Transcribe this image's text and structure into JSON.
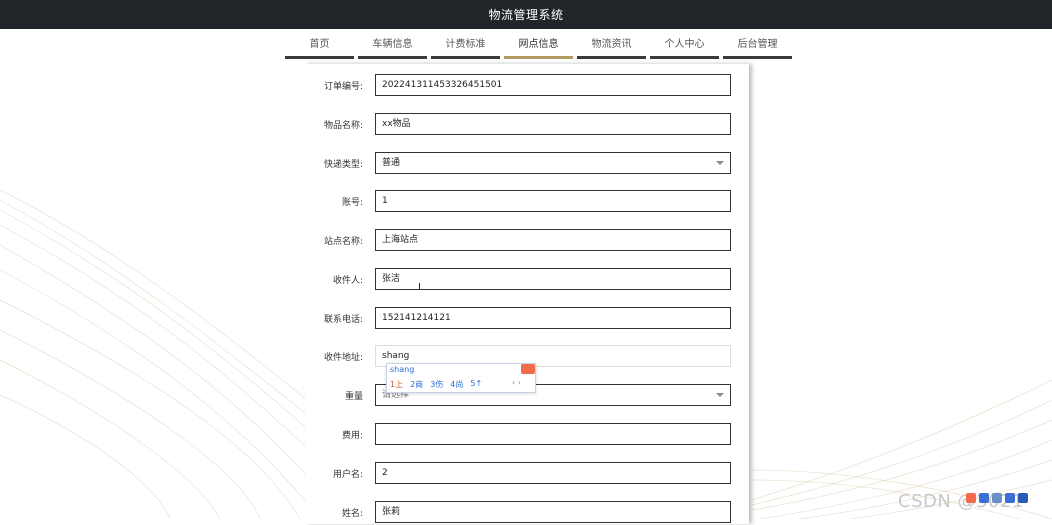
{
  "header": {
    "title": "物流管理系统"
  },
  "nav": {
    "tabs": [
      {
        "label": "首页",
        "active": false
      },
      {
        "label": "车辆信息",
        "active": false
      },
      {
        "label": "计费标准",
        "active": false
      },
      {
        "label": "网点信息",
        "active": true
      },
      {
        "label": "物流资讯",
        "active": false
      },
      {
        "label": "个人中心",
        "active": false
      },
      {
        "label": "后台管理",
        "active": false
      }
    ]
  },
  "form": {
    "order_no": {
      "label": "订单编号:",
      "value": "20224131145332645150​1"
    },
    "item_name": {
      "label": "物品名称:",
      "value": "xx物品"
    },
    "express_type": {
      "label": "快递类型:",
      "value": "普通"
    },
    "account": {
      "label": "账号:",
      "value": "1"
    },
    "station_name": {
      "label": "站点名称:",
      "value": "上海站点"
    },
    "receiver": {
      "label": "收件人:",
      "value": "张洁"
    },
    "phone": {
      "label": "联系电话:",
      "value": "152141214121"
    },
    "address": {
      "label": "收件地址:",
      "value": "shang"
    },
    "weight": {
      "label": "重量",
      "placeholder": "请选择"
    },
    "fee": {
      "label": "费用:",
      "value": ""
    },
    "username": {
      "label": "用户名:",
      "value": "2"
    },
    "name": {
      "label": "姓名:",
      "value": "张莉"
    }
  },
  "ime": {
    "composition": "shang",
    "candidates": [
      "1上",
      "2商",
      "3伤",
      "4尚",
      "5↑"
    ],
    "next": "‹ ›"
  },
  "watermark": "CSDN @3021"
}
